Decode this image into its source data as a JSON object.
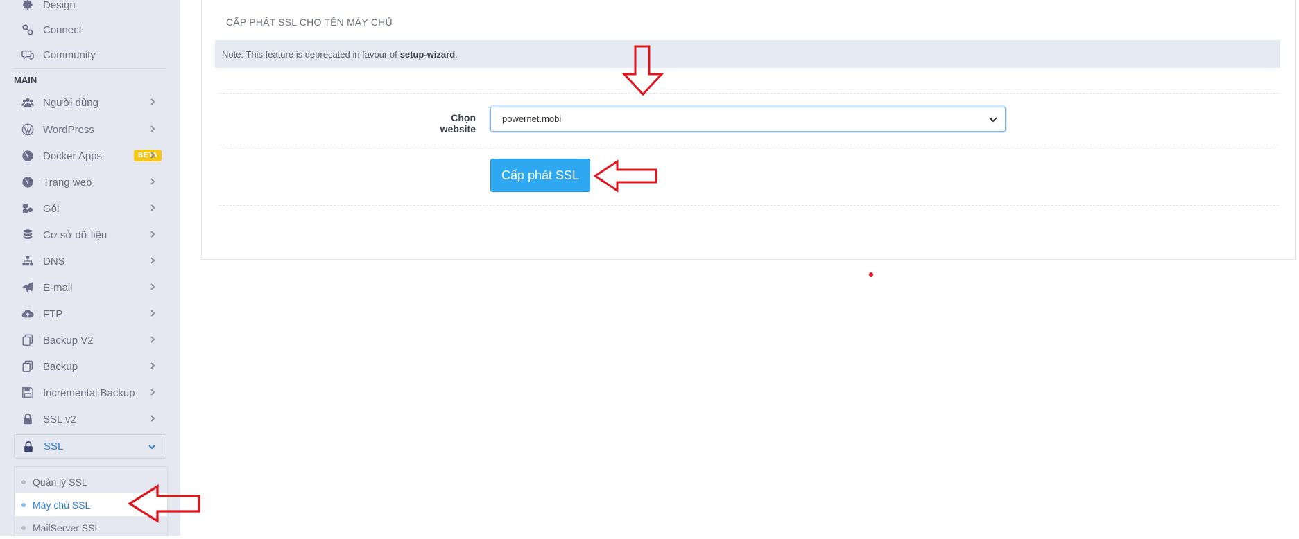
{
  "sidebar": {
    "top_items": [
      {
        "label": "Design",
        "icon": "gear-icon"
      },
      {
        "label": "Connect",
        "icon": "link-icon"
      },
      {
        "label": "Community",
        "icon": "chat-icon"
      }
    ],
    "section_label": "MAIN",
    "items": [
      {
        "label": "Người dùng",
        "icon": "users-icon"
      },
      {
        "label": "WordPress",
        "icon": "wordpress-icon"
      },
      {
        "label": "Docker Apps",
        "icon": "globe-icon",
        "badge": "BETA"
      },
      {
        "label": "Trang web",
        "icon": "globe-icon"
      },
      {
        "label": "Gói",
        "icon": "cubes-icon"
      },
      {
        "label": "Cơ sở dữ liệu",
        "icon": "database-icon"
      },
      {
        "label": "DNS",
        "icon": "sitemap-icon"
      },
      {
        "label": "E-mail",
        "icon": "paper-plane-icon"
      },
      {
        "label": "FTP",
        "icon": "cloud-upload-icon"
      },
      {
        "label": "Backup V2",
        "icon": "copy-icon"
      },
      {
        "label": "Backup",
        "icon": "copy-icon"
      },
      {
        "label": "Incremental Backup",
        "icon": "save-icon"
      },
      {
        "label": "SSL v2",
        "icon": "lock-icon"
      }
    ],
    "ssl_menu": {
      "label": "SSL",
      "icon": "lock-icon"
    },
    "ssl_sub_items": [
      {
        "label": "Quản lý SSL",
        "active": false
      },
      {
        "label": "Máy chủ SSL",
        "active": true
      },
      {
        "label": "MailServer SSL",
        "active": false
      }
    ]
  },
  "main": {
    "card_title": "CẤP PHÁT SSL CHO TÊN MÁY CHỦ",
    "note": {
      "prefix": "Note: This feature is deprecated in favour of",
      "link": "setup-wizard",
      "suffix": "."
    },
    "website_label": "Chọn website",
    "website_select_value": "powernet.mobi",
    "issue_button": "Cấp phát SSL"
  },
  "colors": {
    "sidebar_bg": "#e5e8f0",
    "accent": "#2ea8f0",
    "annotation_red": "#e0141c",
    "badge": "#f5c518"
  }
}
